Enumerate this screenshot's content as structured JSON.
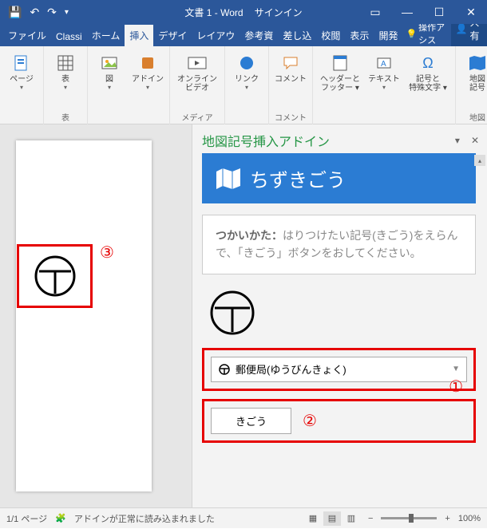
{
  "titlebar": {
    "doc_title": "文書 1 - Word",
    "signin": "サインイン"
  },
  "tabs": {
    "file": "ファイル",
    "classi": "Classi",
    "home": "ホーム",
    "insert": "挿入",
    "design": "デザイ",
    "layout": "レイアウ",
    "references": "参考資",
    "mailings": "差し込",
    "review": "校閲",
    "view": "表示",
    "developer": "開発",
    "tellme": "操作アシス",
    "share": "共有"
  },
  "ribbon": {
    "page": "ページ",
    "table": "表",
    "table_group": "表",
    "pictures": "図",
    "addins": "アドイン",
    "onlinevideo": "オンライン\nビデオ",
    "media_group": "メディア",
    "links": "リンク",
    "comment": "コメント",
    "comment_group": "コメント",
    "headerfooter": "ヘッダーと\nフッター ▾",
    "text": "テキスト",
    "symbols": "記号と\n特殊文字 ▾",
    "map": "地図\n記号",
    "map_group": "地図",
    "fig": "図"
  },
  "panel": {
    "title": "地図記号挿入アドイン",
    "banner": "ちずきごう",
    "help_bold": "つかいかた：",
    "help_text": "はりつけたい記号(きごう)をえらんで、「きごう」ボタンをおしてください。",
    "combo_value": "郵便局(ゆうびんきょく)",
    "button": "きごう"
  },
  "callouts": {
    "n1": "①",
    "n2": "②",
    "n3": "③"
  },
  "status": {
    "page": "1/1 ページ",
    "addin": "アドインが正常に読み込まれました",
    "zoom": "100%"
  }
}
